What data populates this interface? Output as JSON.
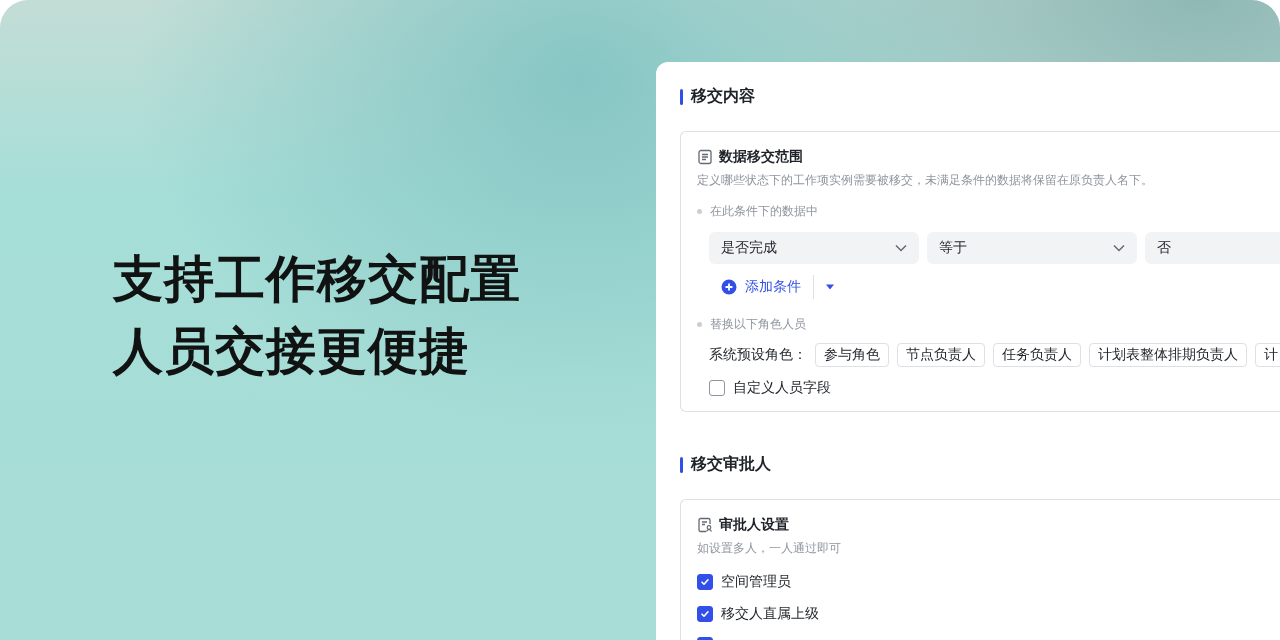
{
  "headline": [
    "支持工作移交配置",
    "人员交接更便捷"
  ],
  "sections": [
    {
      "kind": "scope",
      "title": "移交内容",
      "card": {
        "title": "数据移交范围",
        "description": "定义哪些状态下的工作项实例需要被移交，未满足条件的数据将保留在原负责人名下。",
        "condition_label": "在此条件下的数据中",
        "condition": [
          {
            "value": "是否完成",
            "dropdown": true
          },
          {
            "value": "等于",
            "dropdown": true
          },
          {
            "value": "否"
          }
        ],
        "add_button": "添加条件",
        "roles_label": "替换以下角色人员",
        "preset_label": "系统预设角色：",
        "preset_roles": [
          "参与角色",
          "节点负责人",
          "任务负责人",
          "计划表整体排期负责人",
          "计"
        ],
        "custom_field": {
          "label": "自定义人员字段",
          "checked": false
        }
      }
    },
    {
      "kind": "approvers",
      "title": "移交审批人",
      "card": {
        "title": "审批人设置",
        "description": "如设置多人，一人通过即可",
        "items": [
          {
            "label": "空间管理员",
            "checked": true
          },
          {
            "label": "移交人直属上级",
            "checked": true
          },
          {
            "checked": true
          }
        ]
      }
    }
  ]
}
